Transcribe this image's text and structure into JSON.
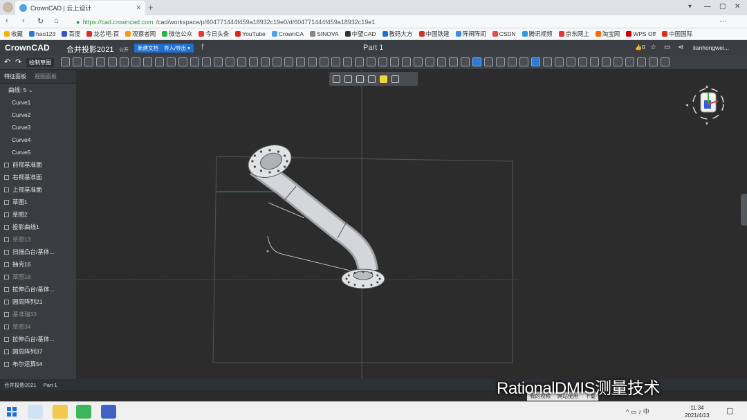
{
  "browser": {
    "tab_title": "CrownCAD | 云上设计",
    "url_host": "https://cad.crowncad.com",
    "url_path": "/cad/workspace/p/604771444f459a18932c19e0/d/604771444f459a18932c19e1",
    "bookmarks": [
      "收藏",
      "hao123",
      "百度",
      "龙芯吧-百",
      "观察者网",
      "微信公众",
      "今日头条",
      "YouTube",
      "CrownCA",
      "SINOVA",
      "中望CAD",
      "教码大方",
      "中国铁建",
      "阵闸阵间",
      "CSDN",
      "腾讯视频",
      "京东网上",
      "淘宝网",
      "WPS Off",
      "中国国际"
    ]
  },
  "app": {
    "logo": "CrownCAD",
    "project_name": "合并投影2021",
    "visibility": "公开",
    "new_doc": "新建文档",
    "import_export": "导入/导出 ▾",
    "doc_title": "Part 1",
    "like_count": "0",
    "user": "lianhongwei..."
  },
  "toolbar": {
    "sketch_label": "绘制草图"
  },
  "panel": {
    "tab_features": "特征面板",
    "tab_views": "视图面板",
    "group_label": "曲线: 5 ⌄",
    "items": [
      {
        "label": "Curve1",
        "sub": true,
        "dim": false
      },
      {
        "label": "Curve2",
        "sub": true,
        "dim": false
      },
      {
        "label": "Curve3",
        "sub": true,
        "dim": false
      },
      {
        "label": "Curve4",
        "sub": true,
        "dim": false
      },
      {
        "label": "Curve5",
        "sub": true,
        "dim": false
      },
      {
        "label": "前视基准面",
        "sub": false,
        "dim": false
      },
      {
        "label": "右视基准面",
        "sub": false,
        "dim": false
      },
      {
        "label": "上视基准面",
        "sub": false,
        "dim": false
      },
      {
        "label": "草图1",
        "sub": false,
        "dim": false
      },
      {
        "label": "草图2",
        "sub": false,
        "dim": false
      },
      {
        "label": "投影曲线1",
        "sub": false,
        "dim": false
      },
      {
        "label": "草图13",
        "sub": false,
        "dim": true
      },
      {
        "label": "扫描凸台/基体...",
        "sub": false,
        "dim": false
      },
      {
        "label": "抽壳16",
        "sub": false,
        "dim": false
      },
      {
        "label": "草图18",
        "sub": false,
        "dim": true
      },
      {
        "label": "拉伸凸台/基体...",
        "sub": false,
        "dim": false
      },
      {
        "label": "圆周阵列21",
        "sub": false,
        "dim": false
      },
      {
        "label": "基准轴33",
        "sub": false,
        "dim": true
      },
      {
        "label": "草图34",
        "sub": false,
        "dim": true
      },
      {
        "label": "拉伸凸台/基体...",
        "sub": false,
        "dim": false
      },
      {
        "label": "圆周阵列37",
        "sub": false,
        "dim": false
      },
      {
        "label": "布尔运算54",
        "sub": false,
        "dim": false
      }
    ]
  },
  "status": {
    "crumb1": "合并投影2021",
    "crumb2": "Part 1"
  },
  "footer": {
    "link1": "我的视频",
    "link2": "网站使用",
    "link3": "下载"
  },
  "watermark": "RationalDMIS测量技术",
  "taskbar": {
    "time": "11:34",
    "date": "2021/4/13"
  },
  "colors": {
    "accent": "#1f6fd1",
    "green_url": "#2a9c3f",
    "pipe": "#c9cbcf"
  }
}
